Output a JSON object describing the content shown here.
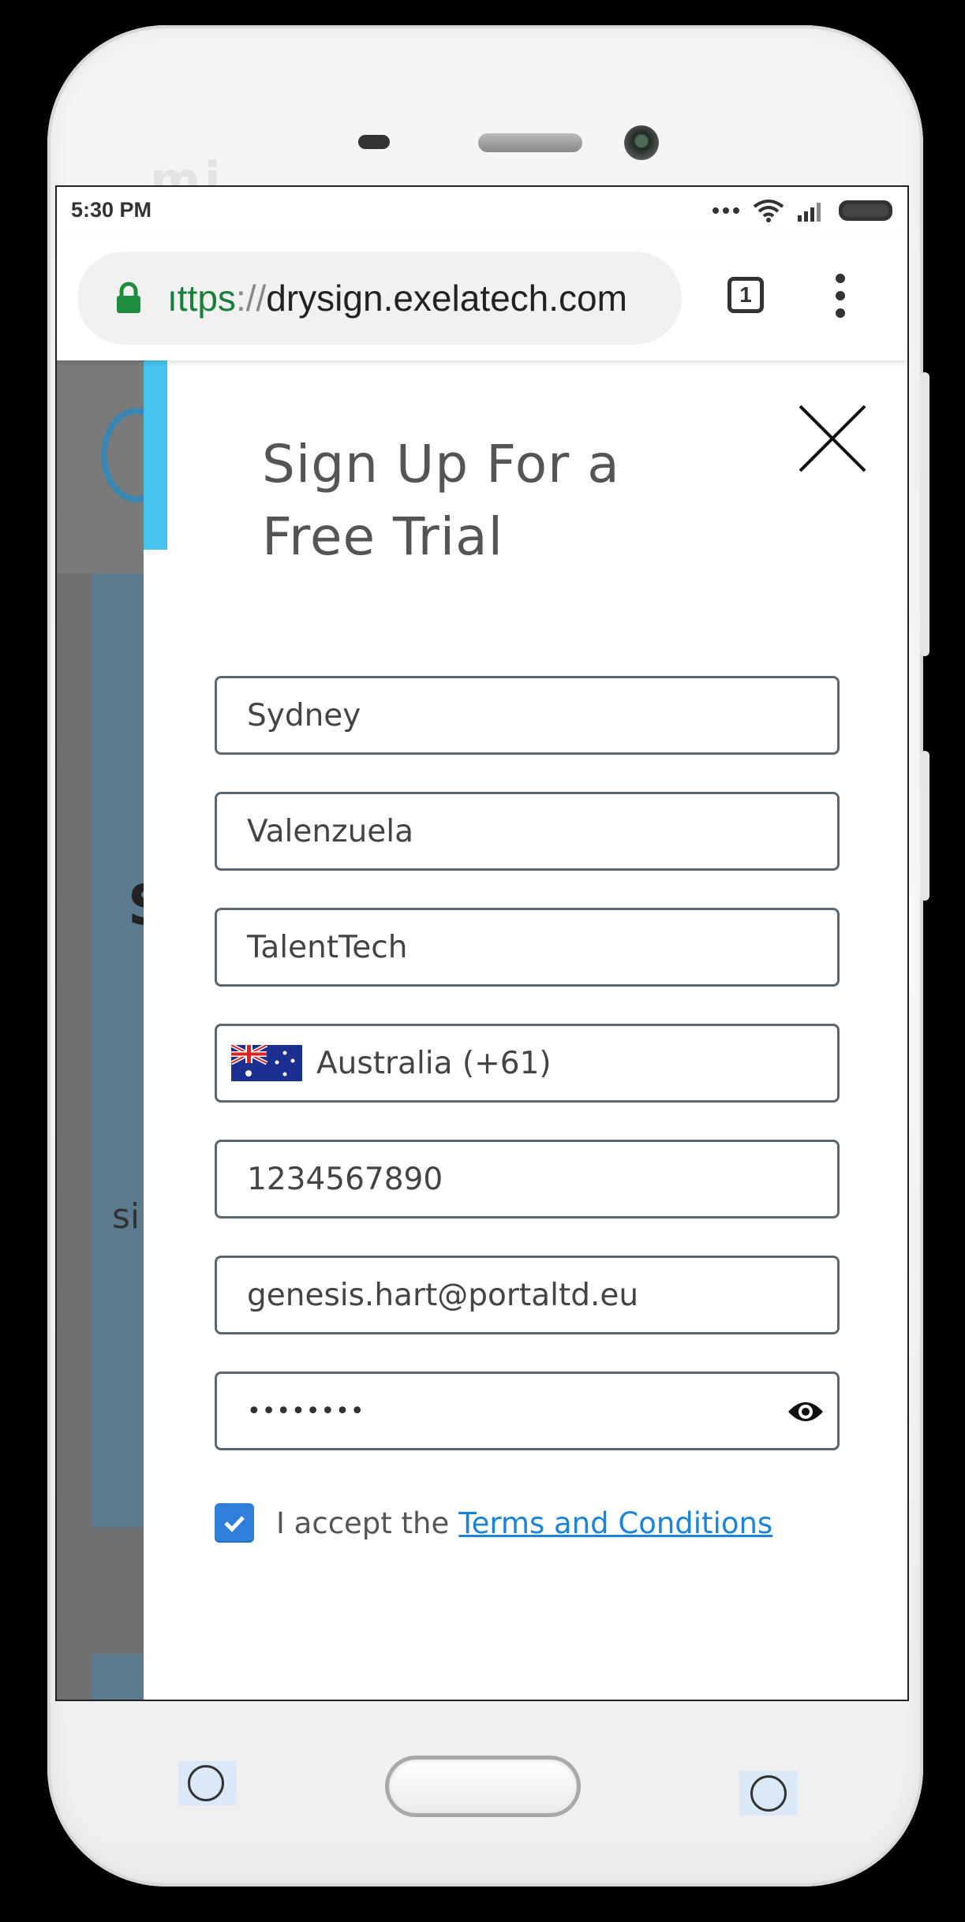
{
  "status_bar": {
    "time": "5:30 PM",
    "icons": [
      "more-dots-icon",
      "wifi-icon",
      "signal-icon",
      "battery-icon"
    ]
  },
  "browser": {
    "url_scheme": "ıttps",
    "url_separator": "://",
    "url_host": "drysign.exelatech.com",
    "tab_count": "1",
    "icons": [
      "lock-icon",
      "overflow-menu-icon"
    ]
  },
  "background_page": {
    "glyph_1": "S",
    "glyph_2": "si"
  },
  "modal": {
    "title_line1": "Sign Up For a",
    "title_line2": "Free Trial",
    "accent_color": "#46c3ee",
    "fields": {
      "first_name": "Sydney",
      "last_name": "Valenzuela",
      "company": "TalentTech",
      "country": "Australia (+61)",
      "phone": "1234567890",
      "email": "genesis.hart@portaltd.eu",
      "password_masked": "••••••••"
    },
    "terms": {
      "checked": true,
      "prefix": "I accept the",
      "link_text": "Terms and Conditions",
      "link_color": "#1a85d8"
    }
  },
  "device": {
    "brand_logo": "mi"
  }
}
